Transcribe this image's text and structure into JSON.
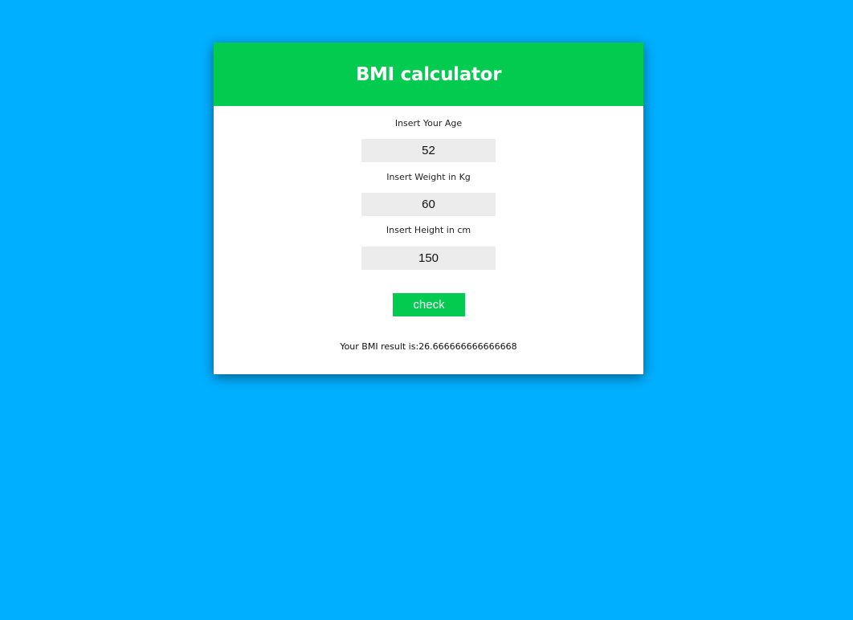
{
  "page": {
    "background_color": "#00afff",
    "accent_color": "#02cb50"
  },
  "header": {
    "title": "BMI calculator"
  },
  "form": {
    "age": {
      "label": "Insert Your Age",
      "value": "52"
    },
    "weight": {
      "label": "Insert Weight in Kg",
      "value": "60"
    },
    "height": {
      "label": "Insert Height in cm",
      "value": "150"
    },
    "submit_label": "check"
  },
  "result": {
    "prefix": "Your BMI result is:",
    "value": "26.666666666666668"
  }
}
